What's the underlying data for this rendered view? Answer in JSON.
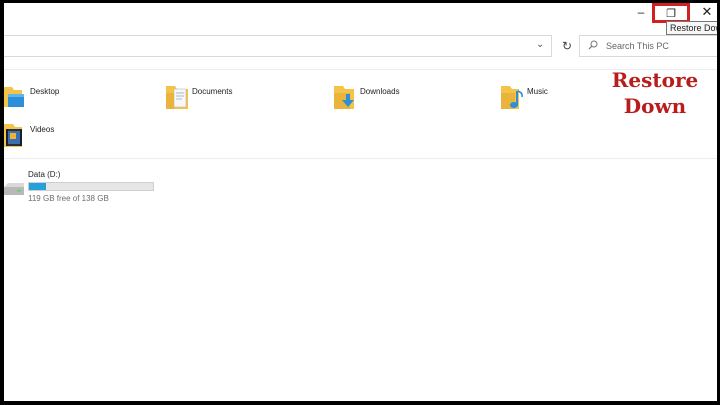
{
  "window": {
    "minimize_glyph": "–",
    "maximize_glyph": "❐",
    "close_glyph": "✕",
    "tooltip": "Restore Down"
  },
  "address": {
    "chevron": "⌄",
    "refresh_glyph": "↻"
  },
  "search": {
    "placeholder": "Search This PC",
    "value": ""
  },
  "folders": [
    {
      "label": "Desktop",
      "icon": "desktop-folder-icon"
    },
    {
      "label": "Documents",
      "icon": "documents-folder-icon"
    },
    {
      "label": "Downloads",
      "icon": "downloads-folder-icon"
    },
    {
      "label": "Music",
      "icon": "music-folder-icon"
    },
    {
      "label": "Videos",
      "icon": "videos-folder-icon"
    }
  ],
  "drive": {
    "label": "Data (D:)",
    "free_text": "119 GB free of 138 GB",
    "used_fraction": 0.138,
    "icon": "drive-icon"
  },
  "annotation": {
    "line1": "Restore",
    "line2": "Down"
  },
  "colors": {
    "highlight": "#d0201f",
    "annotation_text": "#b91c1c",
    "drive_fill": "#26a0da",
    "folder_yellow": "#f4c44a"
  }
}
